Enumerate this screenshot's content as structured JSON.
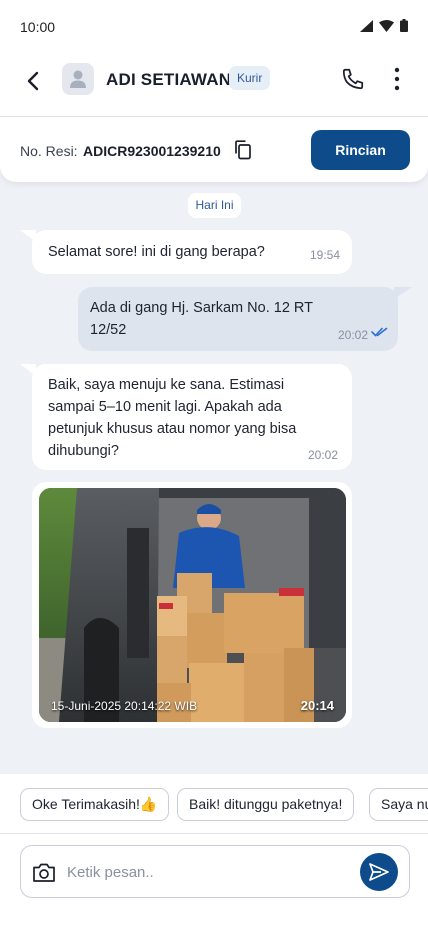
{
  "status_bar": {
    "time": "10:00"
  },
  "header": {
    "contact_name": "ADI SETIAWAN",
    "role_badge": "Kurir"
  },
  "resi": {
    "label": "No. Resi:",
    "value": "ADICR923001239210",
    "details_button": "Rincian"
  },
  "date_separator": "Hari Ini",
  "messages": [
    {
      "direction": "incoming",
      "text": "Selamat sore! ini di gang berapa?",
      "time": "19:54"
    },
    {
      "direction": "outgoing",
      "text": "Ada di gang Hj. Sarkam No. 12 RT 12/52",
      "time": "20:02",
      "status": "read"
    },
    {
      "direction": "incoming",
      "text": "Baik, saya menuju ke sana. Estimasi sampai 5–10 menit lagi. Apakah ada petunjuk khusus atau nomor yang bisa dihubungi?",
      "time": "20:02"
    },
    {
      "direction": "incoming",
      "type": "photo",
      "photo_stamp": "15-Juni-2025 20:14:22 WIB",
      "time": "20:14"
    }
  ],
  "quick_replies": [
    "Oke Terimakasih!👍",
    "Baik! ditunggu paketnya!",
    "Saya nu"
  ],
  "composer": {
    "placeholder": "Ketik pesan.."
  },
  "colors": {
    "primary": "#0e4b8a",
    "outgoing_bubble": "#dde4ee",
    "background": "#eef1f6",
    "read_check": "#2f6fd0"
  }
}
